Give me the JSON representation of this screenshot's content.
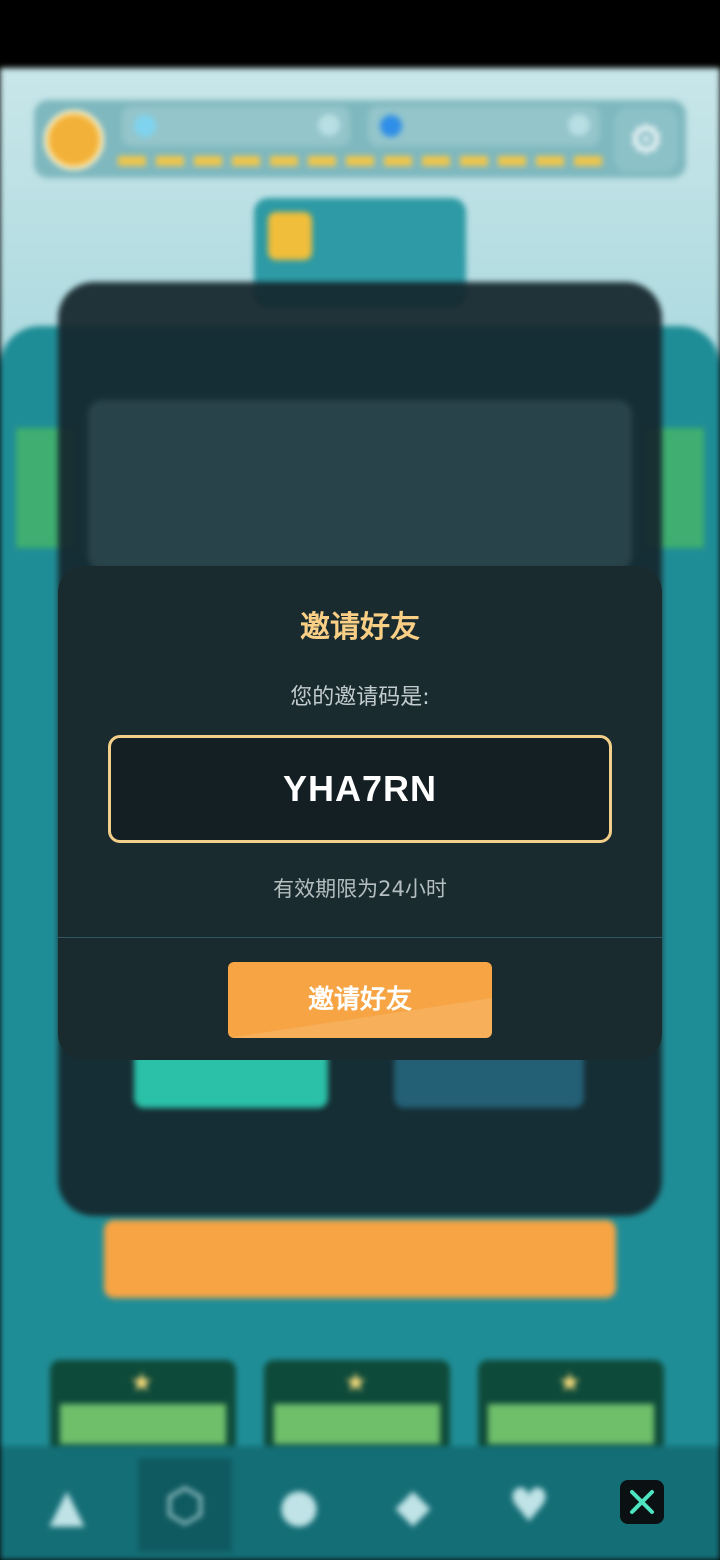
{
  "modal": {
    "title": "邀请好友",
    "code_caption": "您的邀请码是:",
    "invite_code": "YHA7RN",
    "validity_note": "有效期限为24小时",
    "invite_button_label": "邀请好友"
  },
  "colors": {
    "accent_orange": "#f6a444",
    "title_gold": "#f9cf85",
    "close_icon": "#4ee3c1"
  }
}
